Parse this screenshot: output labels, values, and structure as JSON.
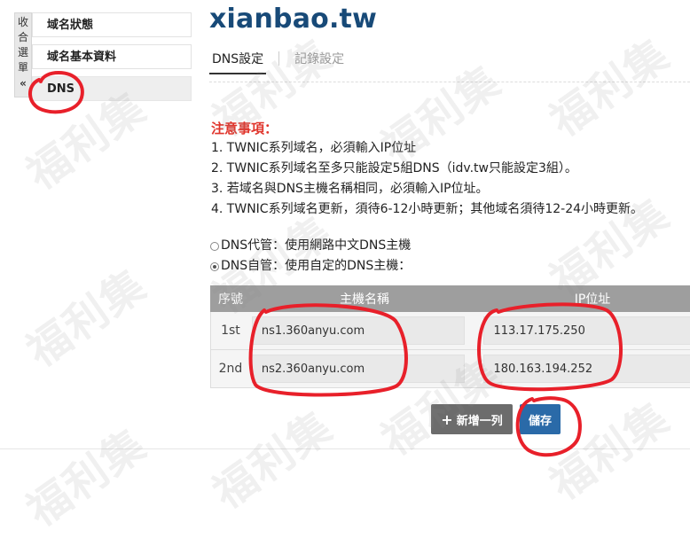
{
  "collapse_menu": {
    "chars": [
      "收",
      "合",
      "選",
      "單"
    ],
    "chevron": "«"
  },
  "sidebar": {
    "items": [
      {
        "label": "域名狀態"
      },
      {
        "label": "域名基本資料"
      },
      {
        "label": "DNS"
      }
    ]
  },
  "header": {
    "domain": "xianbao.tw"
  },
  "tabs": [
    {
      "label": "DNS設定"
    },
    {
      "label": "記錄設定"
    }
  ],
  "notes": {
    "title": "注意事項：",
    "lines": [
      "1. TWNIC系列域名，必須輸入IP位址",
      "2. TWNIC系列域名至多只能設定5組DNS（idv.tw只能設定3組）。",
      "3. 若域名與DNS主機名稱相同，必須輸入IP位址。",
      "4. TWNIC系列域名更新，須待6-12小時更新；其他域名須待12-24小時更新。"
    ]
  },
  "dns_options": [
    {
      "label": "DNS代管：使用網路中文DNS主機",
      "checked": false
    },
    {
      "label": "DNS自管：使用自定的DNS主機：",
      "checked": true
    }
  ],
  "table": {
    "headers": [
      "序號",
      "主機名稱",
      "IP位址"
    ],
    "rows": [
      {
        "num": "1st",
        "host": "ns1.360anyu.com",
        "ip": "113.17.175.250"
      },
      {
        "num": "2nd",
        "host": "ns2.360anyu.com",
        "ip": "180.163.194.252"
      }
    ]
  },
  "buttons": {
    "add_row": "新增一列",
    "save": "儲存"
  },
  "watermark": "福利集",
  "colors": {
    "title": "#184a78",
    "note_title": "#e0352c",
    "table_header": "#9e9e9e",
    "save_button": "#2a6aa8",
    "add_button": "#6c6c6c",
    "annotation": "#e8202a"
  }
}
